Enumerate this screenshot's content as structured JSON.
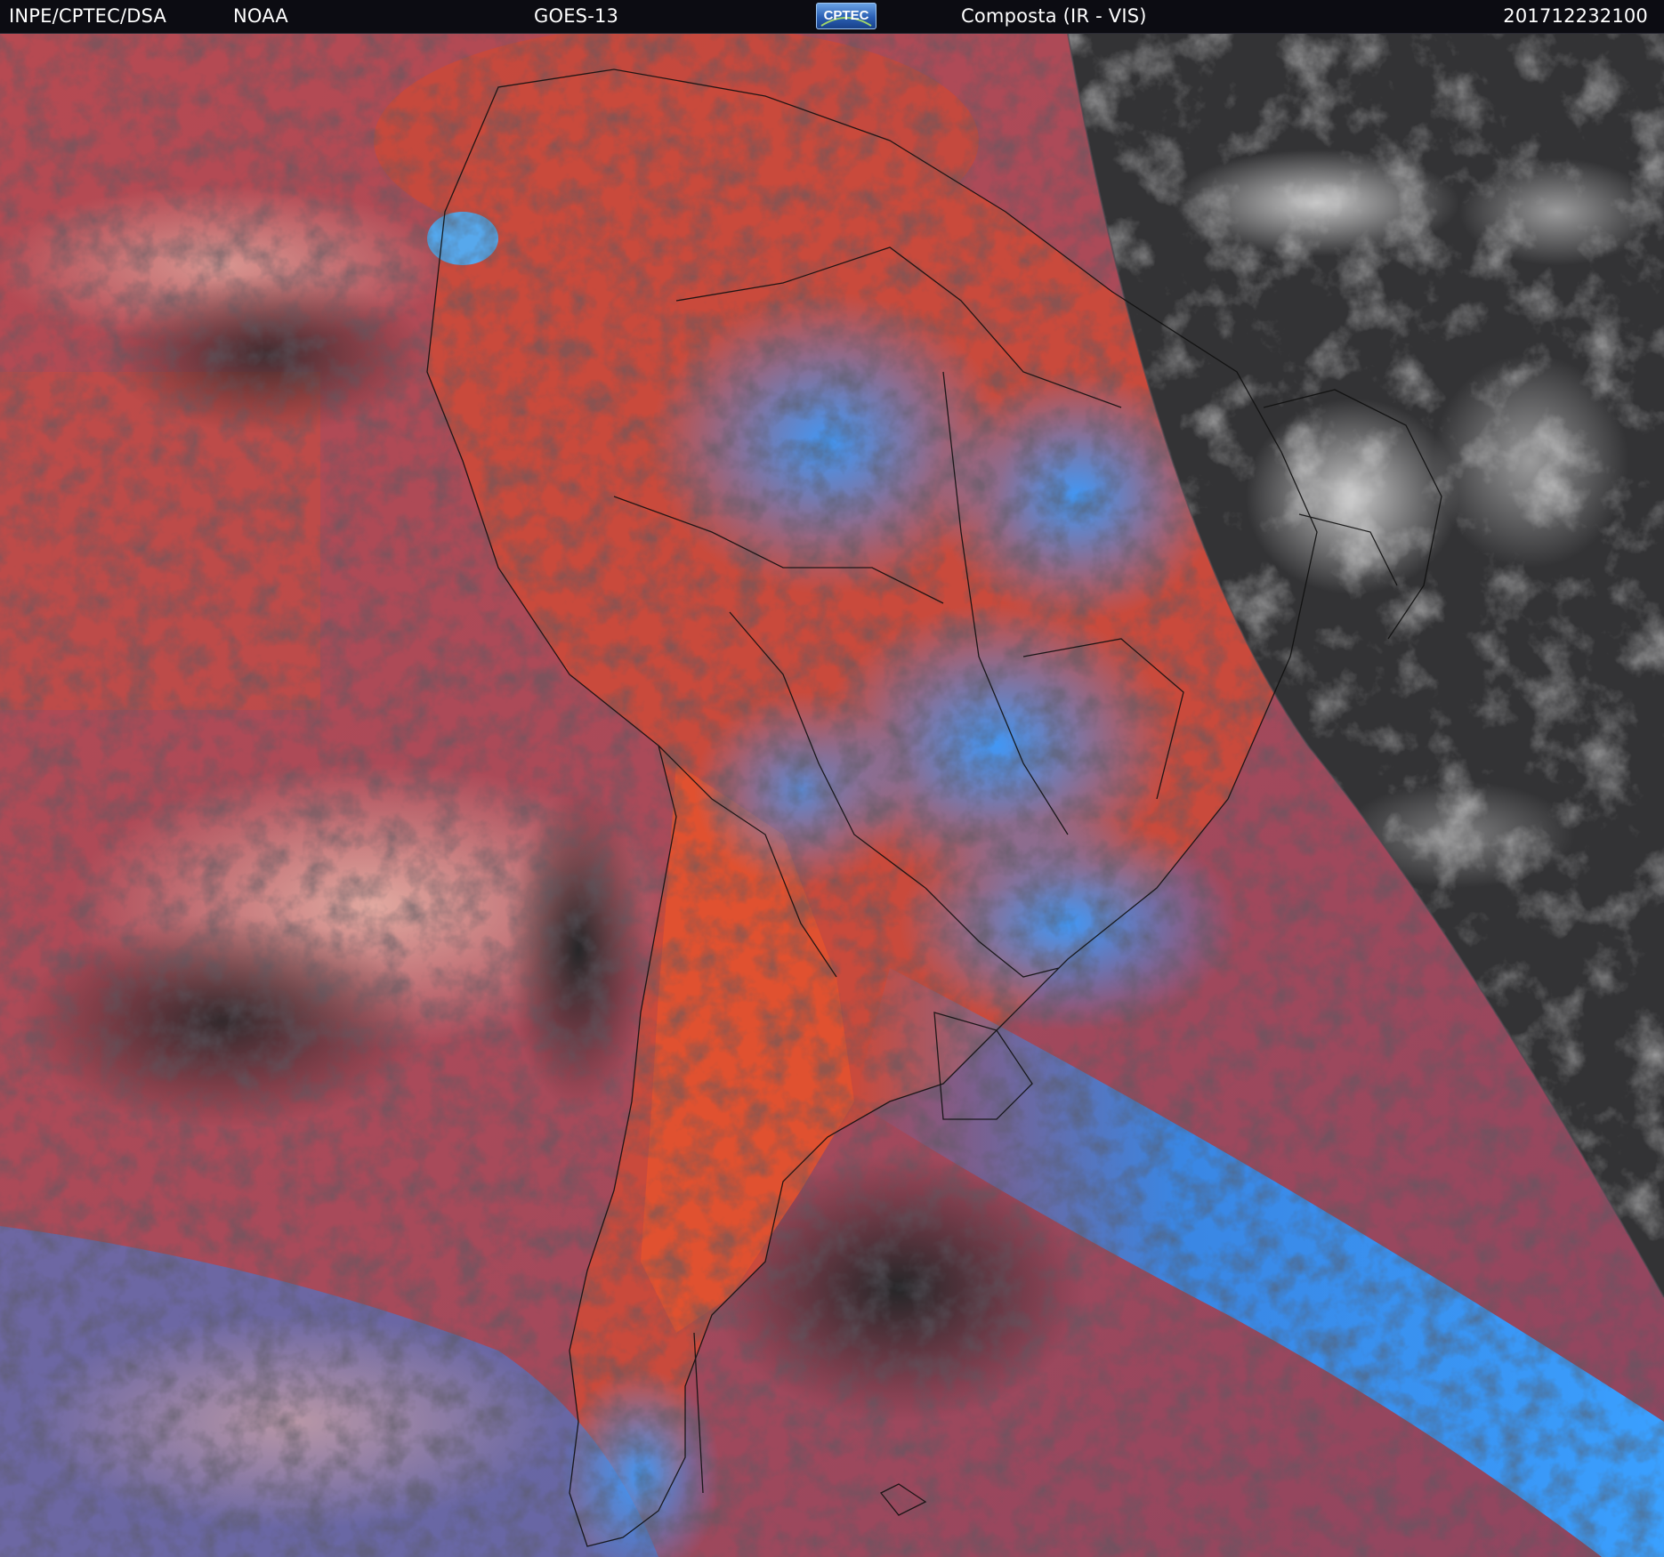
{
  "header": {
    "org": "INPE/CPTEC/DSA",
    "agency": "NOAA",
    "satellite": "GOES-13",
    "logo_text": "CPTEC",
    "product": "Composta (IR - VIS)",
    "timestamp": "201712232100"
  },
  "colors": {
    "ocean_dark": "#2b2b2d",
    "ir_red": "#c9493a",
    "ir_orange": "#e2522f",
    "cloud_blue": "#2f8df2",
    "vis_gray": "#3a3a3c",
    "vis_cloud": "#d8d8d8",
    "border_lines": "#101010"
  },
  "icons": {
    "logo": "cptec-logo"
  }
}
